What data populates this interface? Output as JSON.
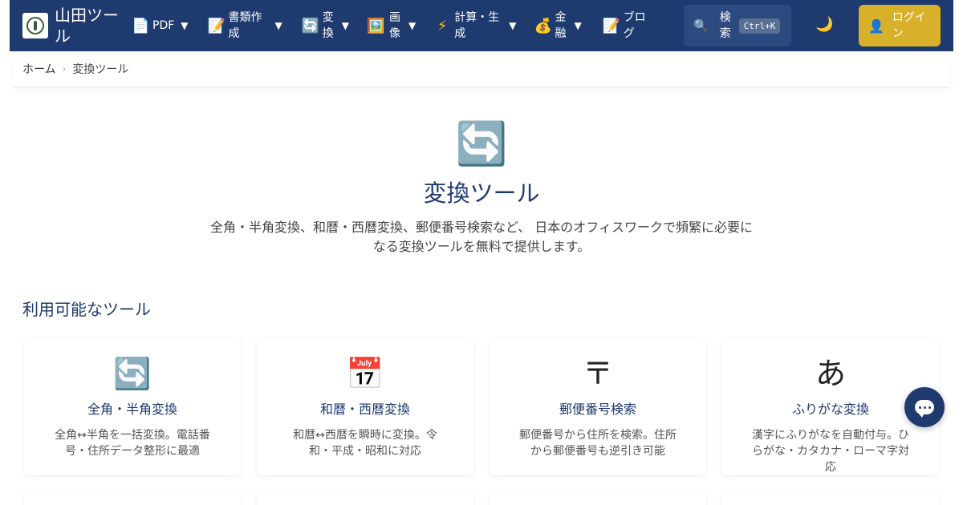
{
  "header": {
    "brand": "山田ツール",
    "nav": [
      {
        "icon": "📄",
        "icon_name": "document-icon",
        "label": "PDF"
      },
      {
        "icon": "📝",
        "icon_name": "memo-icon",
        "label": "書類作成"
      },
      {
        "icon": "🔄",
        "icon_name": "convert-icon",
        "label": "変換"
      },
      {
        "icon": "🖼️",
        "icon_name": "image-icon",
        "label": "画像"
      },
      {
        "icon": "⚡",
        "icon_name": "lightning-icon",
        "label": "計算・生成"
      },
      {
        "icon": "💰",
        "icon_name": "money-bag-icon",
        "label": "金融"
      },
      {
        "icon": "📝",
        "icon_name": "memo-icon",
        "label": "ブログ"
      }
    ],
    "caret": "▼",
    "search": {
      "label": "検索",
      "shortcut": "Ctrl+K"
    },
    "login": "ログイン"
  },
  "breadcrumb": {
    "home": "ホーム",
    "separator": "›",
    "current": "変換ツール"
  },
  "hero": {
    "title": "変換ツール",
    "description": "全角・半角変換、和暦・西暦変換、郵便番号検索など、 日本のオフィスワークで頻繁に必要になる変換ツールを無料で提供します。"
  },
  "section_title": "利用可能なツール",
  "cards": [
    {
      "icon": "🔄",
      "icon_name": "convert-icon",
      "title": "全角・半角変換",
      "desc": "全角↔半角を一括変換。電話番号・住所データ整形に最適"
    },
    {
      "icon": "📅",
      "icon_name": "calendar-icon",
      "title": "和暦・西暦変換",
      "desc": "和暦↔西暦を瞬時に変換。令和・平成・昭和に対応"
    },
    {
      "icon": "〒",
      "icon_name": "postal-mark-icon",
      "title": "郵便番号検索",
      "desc": "郵便番号から住所を検索。住所から郵便番号も逆引き可能"
    },
    {
      "icon": "あ",
      "icon_name": "hiragana-icon",
      "title": "ふりがな変換",
      "desc": "漢字にふりがなを自動付与。ひらがな・カタカナ・ローマ字対応"
    }
  ],
  "colors": {
    "header_bg": "#1e3a6e",
    "accent": "#d9b02a",
    "title": "#1e3a6e"
  }
}
